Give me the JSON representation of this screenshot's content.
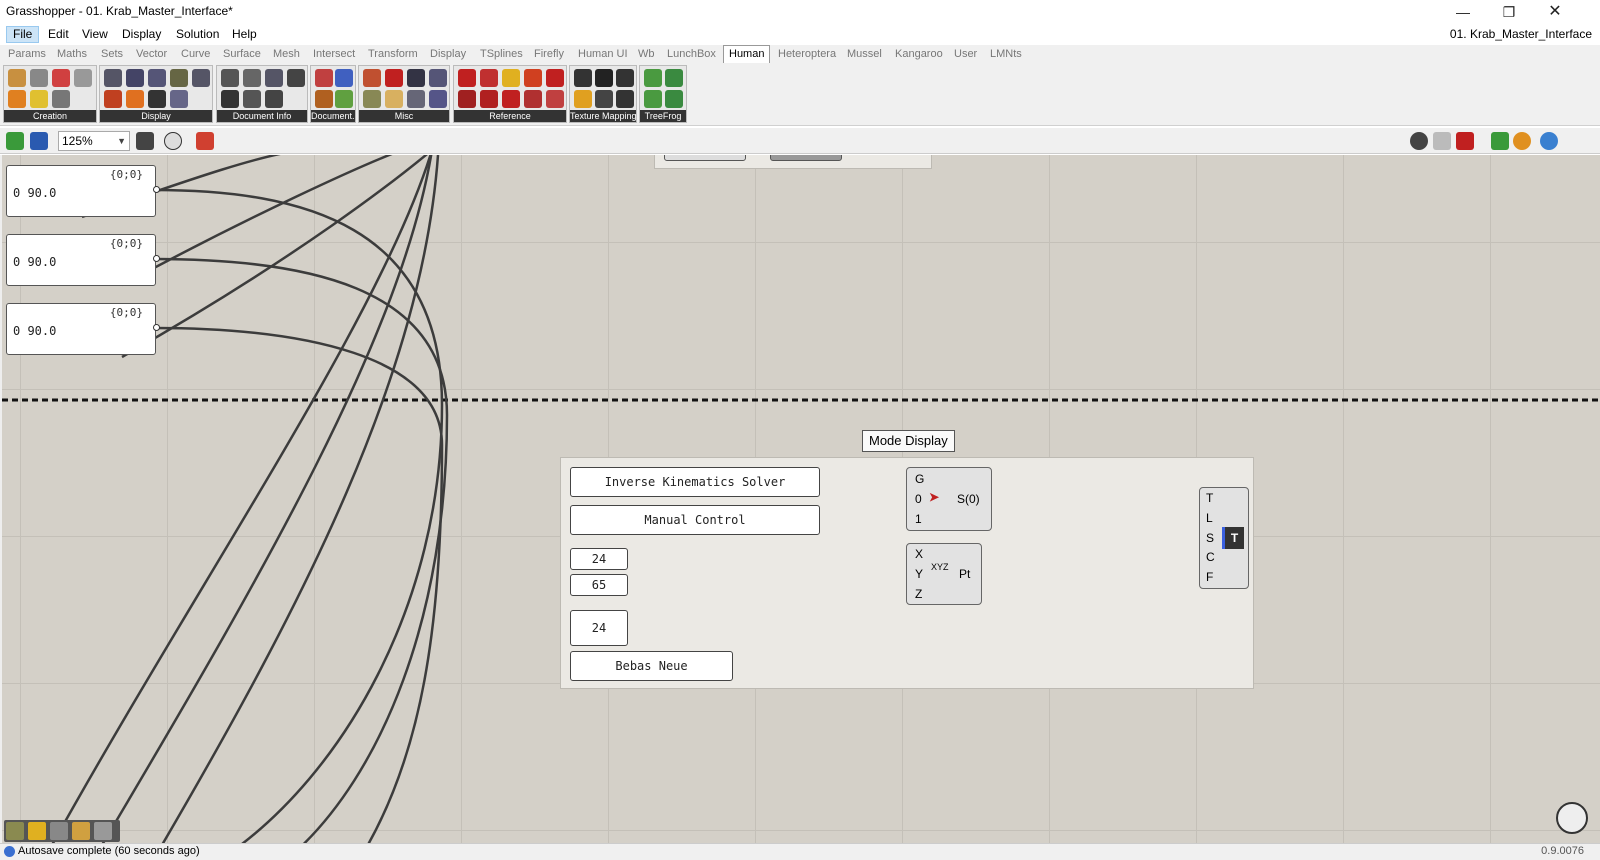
{
  "window": {
    "title": "Grasshopper - 01. Krab_Master_Interface*",
    "controls": [
      "minimize-icon",
      "restore-icon",
      "close-icon"
    ]
  },
  "menu": {
    "items": [
      "File",
      "Edit",
      "View",
      "Display",
      "Solution",
      "Help"
    ],
    "active": "File",
    "document_name": "01. Krab_Master_Interface"
  },
  "ribbon_tabs": {
    "items": [
      "Params",
      "Maths",
      "Sets",
      "Vector",
      "Curve",
      "Surface",
      "Mesh",
      "Intersect",
      "Transform",
      "Display",
      "TSplines",
      "Firefly",
      "Human UI",
      "Wb",
      "LunchBox",
      "Human",
      "Heteroptera",
      "Mussel",
      "Kangaroo",
      "User",
      "LMNts"
    ],
    "active": "Human"
  },
  "ribbon_panels": [
    "Creation",
    "Display",
    "Document Info",
    "Document...",
    "Misc",
    "Reference",
    "Texture Mapping",
    "TreeFrog"
  ],
  "canvas_toolbar": {
    "zoom": "125%"
  },
  "canvas": {
    "panels": [
      {
        "path": "{0;0}",
        "value": "0 90.0"
      },
      {
        "path": "{0;0}",
        "value": "0 90.0"
      },
      {
        "path": "{0;0}",
        "value": "0 90.0"
      }
    ],
    "tooltip": "Mode Display",
    "text_inputs": {
      "ik_solver": "Inverse Kinematics Solver",
      "manual_control": "Manual Control",
      "x_value": "24",
      "y_value": "65",
      "size_value": "24",
      "font_name": "Bebas Neue"
    },
    "stream_filter": {
      "inputs": [
        "G",
        "0",
        "1"
      ],
      "output": "S(0)"
    },
    "construct_point": {
      "inputs": [
        "X",
        "Y",
        "Z"
      ],
      "icon_label": "XYZ",
      "output": "Pt"
    },
    "text_tag": {
      "inputs": [
        "T",
        "L",
        "S",
        "C",
        "F"
      ]
    }
  },
  "status": {
    "message": "Autosave complete (60 seconds ago)",
    "version": "0.9.0076"
  },
  "colors": {
    "canvas_bg": "#d4d0c8",
    "wire": "#3c3c3c",
    "group_bg": "#ebe9e4",
    "accent": "#3a6fd0"
  }
}
